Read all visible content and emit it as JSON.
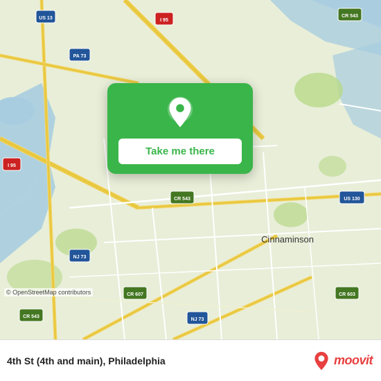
{
  "map": {
    "credit": "© OpenStreetMap contributors"
  },
  "popup": {
    "button_label": "Take me there"
  },
  "bottom_bar": {
    "location_title": "4th St (4th and main), Philadelphia"
  },
  "moovit": {
    "logo_text": "moovit"
  }
}
